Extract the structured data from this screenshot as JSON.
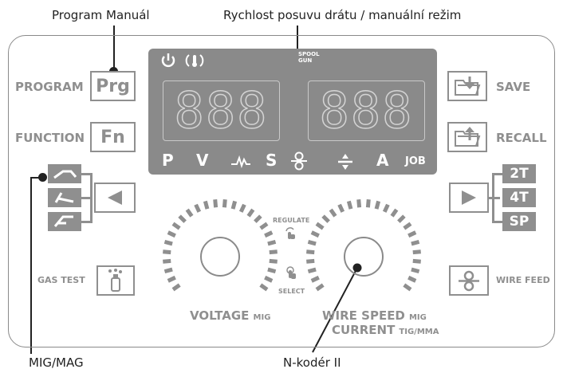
{
  "callouts": {
    "program_manual": "Program Manuál",
    "wire_speed_manual": "Rychlost posuvu drátu / manuální režim",
    "mig_mag": "MIG/MAG",
    "encoder": "N-kodér II"
  },
  "left_panel": {
    "program_label": "PROGRAM",
    "program_button": "Prg",
    "function_label": "FUNCTION",
    "function_button": "Fn",
    "gas_test_label": "GAS TEST"
  },
  "right_panel": {
    "save_label": "SAVE",
    "recall_label": "RECALL",
    "wire_feed_label": "WIRE FEED",
    "mode_2t": "2T",
    "mode_4t": "4T",
    "mode_sp": "SP"
  },
  "display": {
    "spool_gun": "SPOOL GUN",
    "left_digits": "888",
    "right_digits": "888",
    "ind_p": "P",
    "ind_v": "V",
    "ind_s": "S",
    "ind_a": "A",
    "ind_job": "JOB"
  },
  "knobs": {
    "regulate": "REGULATE",
    "select": "SELECT",
    "voltage": "VOLTAGE",
    "voltage_sub": "MIG",
    "wire_speed": "WIRE SPEED",
    "wire_speed_sub": "MIG",
    "current": "CURRENT",
    "current_sub": "TIG/MMA"
  },
  "colors": {
    "panel_gray": "#8f8f8f",
    "display_gray": "#8a8a8a"
  }
}
